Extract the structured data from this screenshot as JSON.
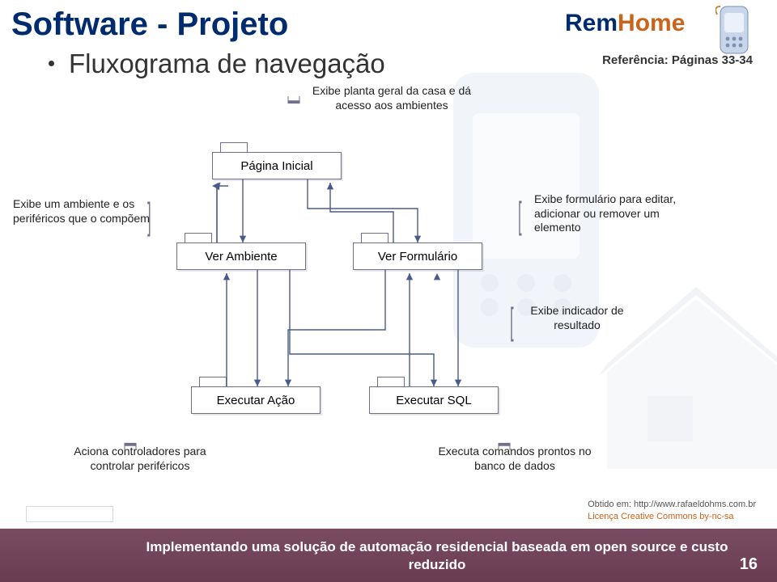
{
  "title": "Software - Projeto",
  "bullet": "Fluxograma de navegação",
  "reference": "Referência: Páginas 33-34",
  "logo": {
    "rem": "Rem",
    "home": "Home"
  },
  "annotations": {
    "top": "Exibe planta geral da casa e dá acesso aos ambientes",
    "left_mid": "Exibe um ambiente e os periféricos que o compõem",
    "right_mid": "Exibe formulário para editar, adicionar ou remover um elemento",
    "result": "Exibe indicador de resultado",
    "bottom_left": "Aciona controladores para controlar periféricos",
    "bottom_right": "Executa comandos prontos no banco de dados"
  },
  "nodes": {
    "inicial": "Página Inicial",
    "ambiente": "Ver Ambiente",
    "formulario": "Ver Formulário",
    "acao": "Executar Ação",
    "sql": "Executar SQL"
  },
  "footer": {
    "line": "Implementando uma solução de automação residencial baseada em open source e custo reduzido",
    "page": "16",
    "obtido": "Obtido em: http://www.rafaeldohms.com.br",
    "licenca": "Licença Creative Commons by-nc-sa"
  }
}
